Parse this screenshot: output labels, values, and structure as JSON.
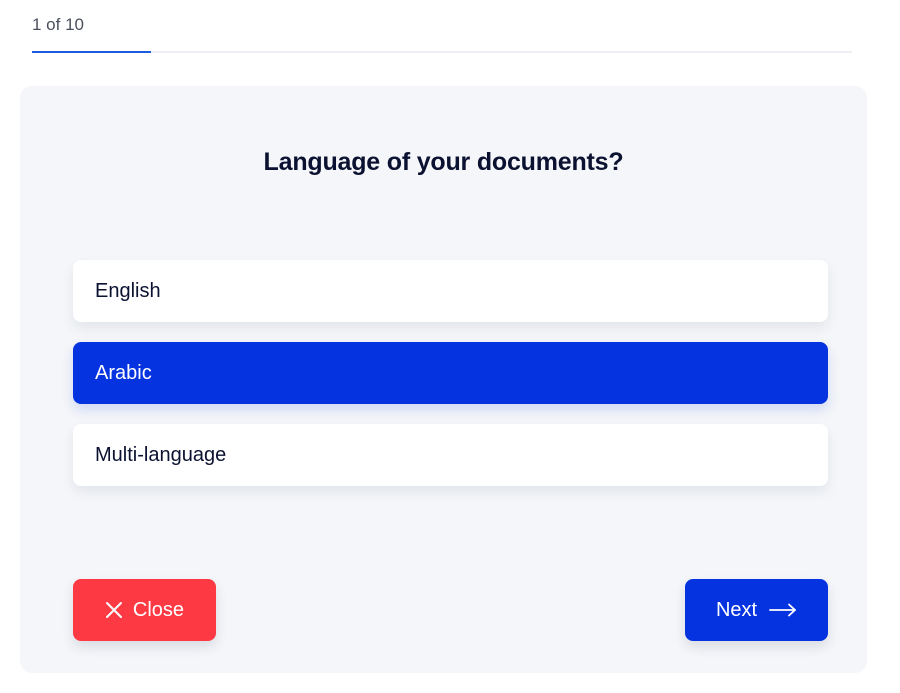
{
  "progress": {
    "label": "1 of 10",
    "current": 1,
    "total": 10,
    "fraction": 0.1
  },
  "question": {
    "title": "Language of your documents?"
  },
  "options": [
    {
      "label": "English",
      "selected": false
    },
    {
      "label": "Arabic",
      "selected": true
    },
    {
      "label": "Multi-language",
      "selected": false
    }
  ],
  "actions": {
    "close_label": "Close",
    "close_icon": "close-icon",
    "next_label": "Next",
    "next_icon": "arrow-right-icon"
  },
  "colors": {
    "accent": "#0533e0",
    "progress": "#1d5cde",
    "danger": "#fd3a43",
    "card_bg": "#f4f6f9",
    "text_dark": "#0b1130"
  }
}
